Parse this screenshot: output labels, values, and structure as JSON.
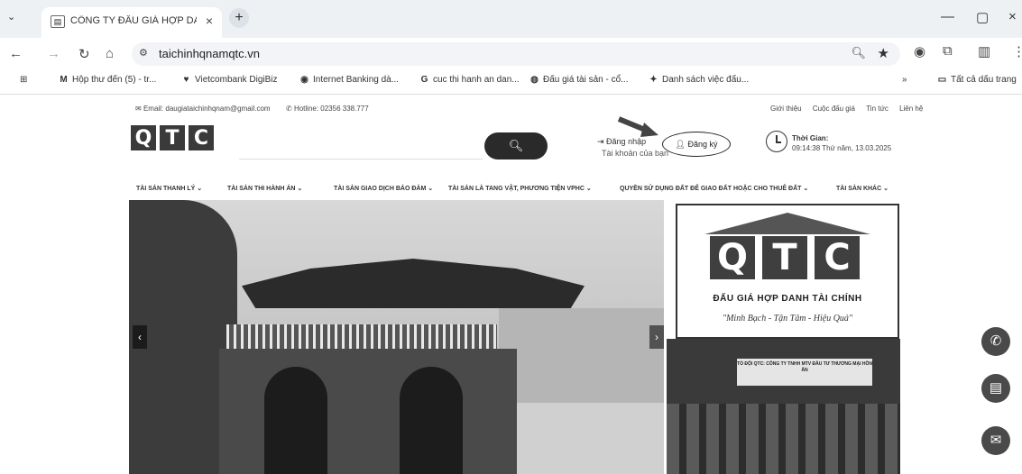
{
  "caption": "...",
  "browser": {
    "tab_title": "CÔNG TY ĐẤU GIÁ HỢP DANH",
    "url": "taichinhqnamqtc.vn",
    "bookmarks": [
      "Hộp thư đến (5) - tr...",
      "Vietcombank DigiBiz",
      "Internet Banking dà...",
      "cuc thi hanh an dan...",
      "Đấu giá tài sản - cổ...",
      "Danh sách việc đấu..."
    ],
    "all_bookmarks": "Tất cả dấu trang"
  },
  "site": {
    "email": "Email: daugiataichinhqnam@gmail.com",
    "hotline": "Hotline: 02356 338.777",
    "top_links": [
      "Giới thiệu",
      "Cuộc đấu giá",
      "Tin tức",
      "Liên hệ"
    ],
    "logo_letters": [
      "Q",
      "T",
      "C"
    ],
    "login": "Đăng nhập",
    "register": "Đăng ký",
    "account": "Tài khoản của bạn",
    "time_label": "Thời Gian:",
    "time_value": "09:14:38 Thứ năm, 13.03.2025",
    "menu": [
      "TÀI SẢN THANH LÝ ⌄",
      "TÀI SẢN THI HÀNH ÁN ⌄",
      "TÀI SẢN GIAO DỊCH BẢO ĐẢM ⌄",
      "TÀI SẢN LÀ TANG VẬT, PHƯƠNG TIỆN VPHC ⌄",
      "QUYỀN SỬ DỤNG ĐẤT ĐỂ GIAO ĐẤT HOẶC CHO THUÊ ĐẤT ⌄",
      "TÀI SẢN KHÁC ⌄"
    ],
    "side_logo_name": "ĐẤU GIÁ HỢP DANH TÀI CHÍNH",
    "side_logo_motto": "\"Minh Bạch - Tận Tâm - Hiệu Quả\"",
    "event_banner": "TỔ ĐỘI QTC: CÔNG TY TNHH MTV ĐẦU TƯ THƯƠNG MẠI HỒN ẤN"
  }
}
